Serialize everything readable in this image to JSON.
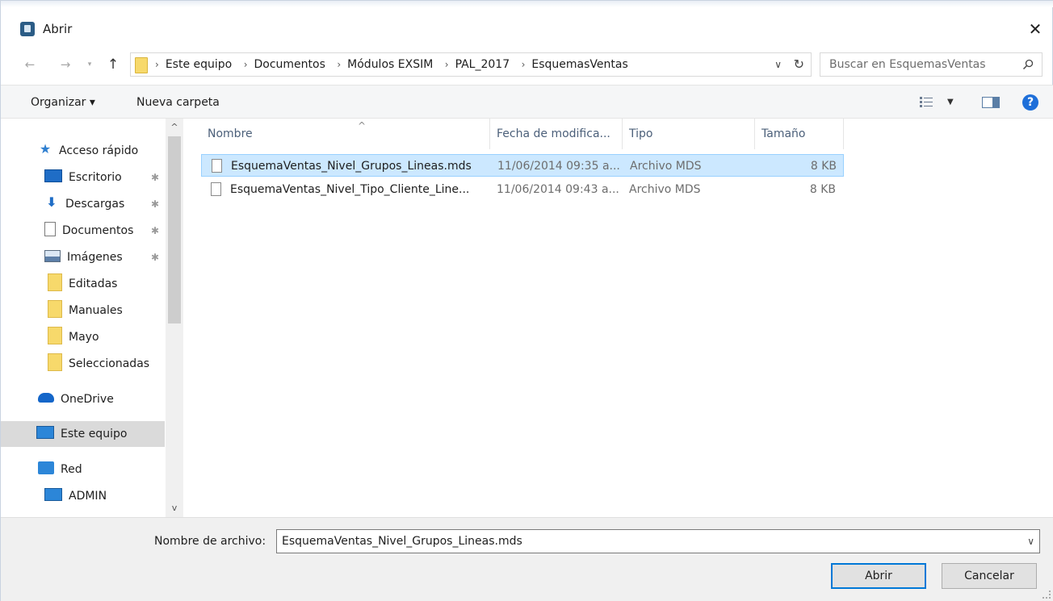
{
  "window": {
    "title": "Abrir",
    "close_glyph": "✕"
  },
  "nav": {
    "back_glyph": "←",
    "forward_glyph": "→",
    "recent_glyph": "▾",
    "up_glyph": "↑",
    "breadcrumbs": [
      "Este equipo",
      "Documentos",
      "Módulos EXSIM",
      "PAL_2017",
      "EsquemasVentas"
    ],
    "separator": "›",
    "dropdown_glyph": "∨",
    "refresh_glyph": "↻",
    "search_placeholder": "Buscar en EsquemasVentas"
  },
  "toolbar": {
    "organize_label": "Organizar ▾",
    "new_folder_label": "Nueva carpeta",
    "view_dropdown_glyph": "▼",
    "help_glyph": "?"
  },
  "sidebar": {
    "items": [
      {
        "label": "Acceso rápido",
        "icon": "star-icon"
      },
      {
        "label": "Escritorio",
        "icon": "desktop-icon",
        "pinned": true
      },
      {
        "label": "Descargas",
        "icon": "download-icon",
        "pinned": true
      },
      {
        "label": "Documentos",
        "icon": "document-icon",
        "pinned": true
      },
      {
        "label": "Imágenes",
        "icon": "image-icon",
        "pinned": true
      },
      {
        "label": "Editadas",
        "icon": "folder-icon"
      },
      {
        "label": "Manuales",
        "icon": "folder-icon"
      },
      {
        "label": "Mayo",
        "icon": "folder-icon"
      },
      {
        "label": "Seleccionadas",
        "icon": "folder-icon"
      },
      {
        "label": "OneDrive",
        "icon": "cloud-icon"
      },
      {
        "label": "Este equipo",
        "icon": "computer-icon",
        "selected": true
      },
      {
        "label": "Red",
        "icon": "network-icon"
      },
      {
        "label": "ADMIN",
        "icon": "computer-icon"
      }
    ],
    "pin_glyph": "✱",
    "scroll_up_glyph": "^",
    "scroll_down_glyph": "v"
  },
  "filelist": {
    "columns": [
      "Nombre",
      "Fecha de modifica...",
      "Tipo",
      "Tamaño"
    ],
    "sort_glyph": "^",
    "rows": [
      {
        "name": "EsquemaVentas_Nivel_Grupos_Lineas.mds",
        "date": "11/06/2014 09:35 a...",
        "type": "Archivo MDS",
        "size": "8 KB",
        "selected": true
      },
      {
        "name": "EsquemaVentas_Nivel_Tipo_Cliente_Line...",
        "date": "11/06/2014 09:43 a...",
        "type": "Archivo MDS",
        "size": "8 KB",
        "selected": false
      }
    ]
  },
  "footer": {
    "filename_label": "Nombre de archivo:",
    "filename_value": "EsquemaVentas_Nivel_Grupos_Lineas.mds",
    "dropdown_glyph": "∨",
    "open_label": "Abrir",
    "cancel_label": "Cancelar"
  },
  "colors": {
    "selection": "#cce8ff",
    "accent": "#0078d7",
    "folder": "#f7d96b"
  }
}
